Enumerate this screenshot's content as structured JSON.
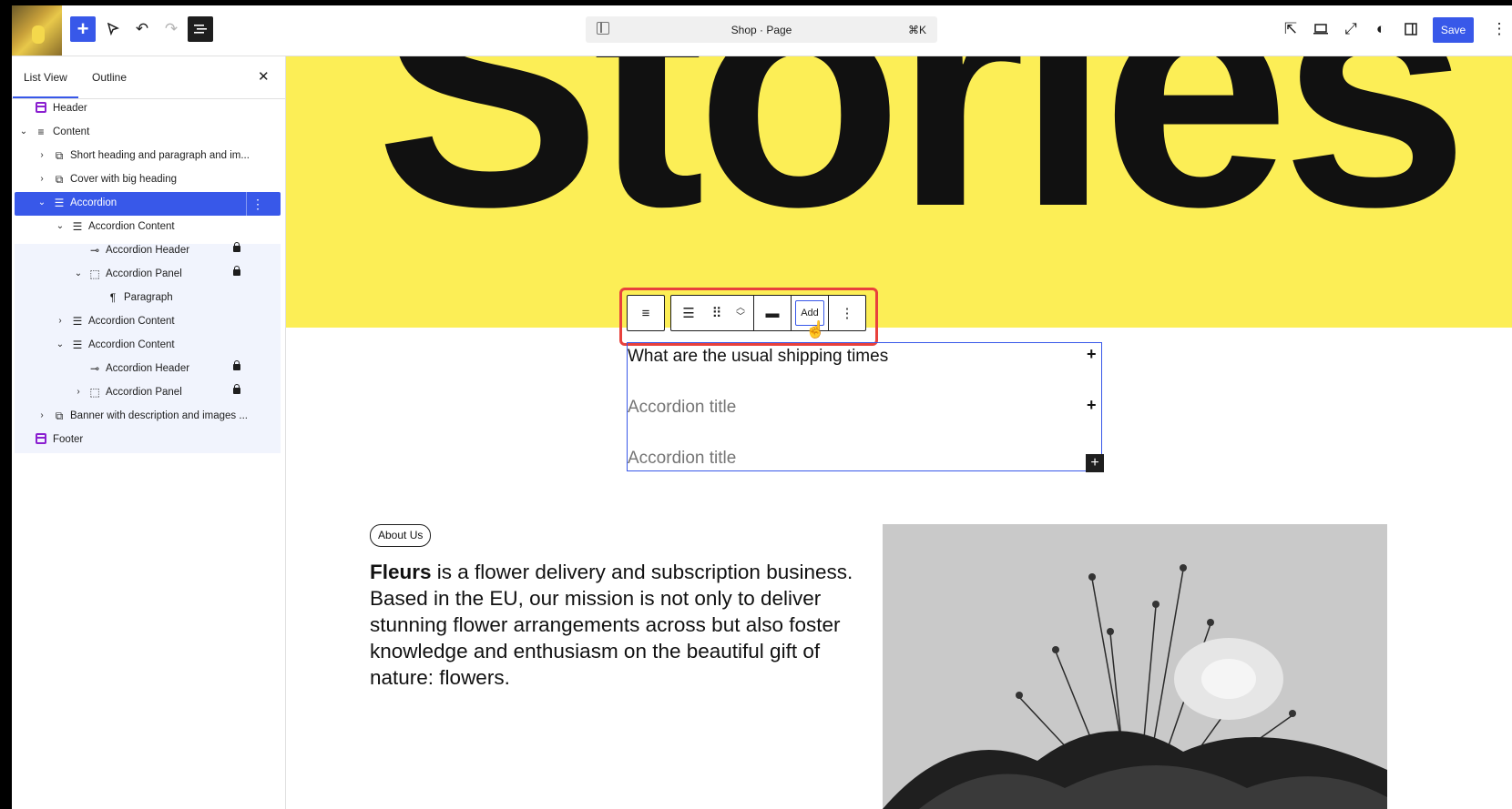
{
  "toolbar": {
    "add_icon": "plus-icon",
    "document_title": "Shop · Page",
    "shortcut": "⌘K",
    "save_label": "Save"
  },
  "sidebar": {
    "tabs": [
      "List View",
      "Outline"
    ],
    "items": [
      {
        "label": "Header"
      },
      {
        "label": "Content"
      },
      {
        "label": "Short heading and paragraph and im..."
      },
      {
        "label": "Cover with big heading"
      },
      {
        "label": "Accordion"
      },
      {
        "label": "Accordion Content"
      },
      {
        "label": "Accordion Header"
      },
      {
        "label": "Accordion Panel"
      },
      {
        "label": "Paragraph"
      },
      {
        "label": "Accordion Content"
      },
      {
        "label": "Accordion Content"
      },
      {
        "label": "Accordion Header"
      },
      {
        "label": "Accordion Panel"
      },
      {
        "label": "Banner with description and images ..."
      },
      {
        "label": "Footer"
      }
    ]
  },
  "canvas": {
    "hero_title": "Stories",
    "block_toolbar": {
      "add_label": "Add"
    },
    "accordion": [
      "What are the usual shipping times",
      "Accordion title",
      "Accordion title"
    ],
    "about_pill": "About Us",
    "about_brand": "Fleurs",
    "about_body": " is a flower delivery and subscription business. Based in the EU, our mission is not only to deliver stunning flower arrangements across but also foster knowledge and enthusiasm on the beautiful gift of nature: flowers."
  },
  "colors": {
    "accent": "#3858e9",
    "hero_bg": "#fcee56",
    "highlight": "#e8413c",
    "layout_icon": "#8b20d0"
  }
}
